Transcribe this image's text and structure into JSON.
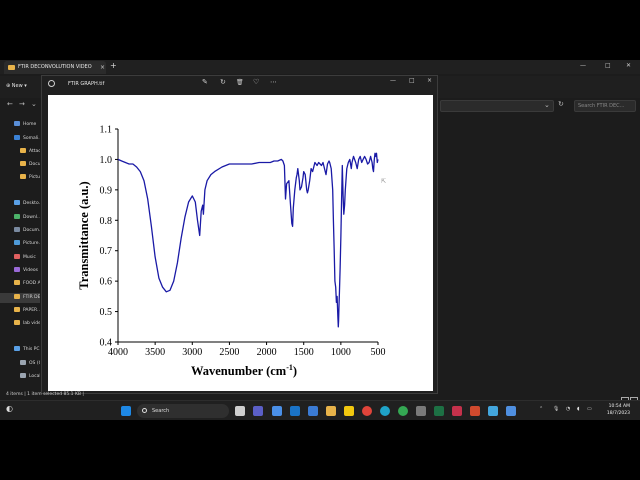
{
  "explorer": {
    "tab_title": "FTIR DECONVOLUTION VIDEO",
    "tab_close": "×",
    "tab_new": "+",
    "new_label": "New",
    "search_placeholder": "Search FTIR DEC...",
    "sidebar": [
      {
        "label": "Home",
        "icon": "home-icon",
        "color": "#5a8fd8"
      },
      {
        "label": "Somali...",
        "icon": "cloud-icon",
        "color": "#3b82d6"
      },
      {
        "label": "Attac...",
        "icon": "folder-icon",
        "color": "#e8b34a"
      },
      {
        "label": "Docu...",
        "icon": "folder-icon",
        "color": "#e8b34a"
      },
      {
        "label": "Pictur...",
        "icon": "folder-icon",
        "color": "#e8b34a"
      },
      {
        "label": "Deskto...",
        "icon": "desktop-icon",
        "color": "#5aa0e6"
      },
      {
        "label": "Downl...",
        "icon": "download-icon",
        "color": "#4cb36a"
      },
      {
        "label": "Docum...",
        "icon": "document-icon",
        "color": "#7a8aa0"
      },
      {
        "label": "Picture...",
        "icon": "pictures-icon",
        "color": "#4e9ad8"
      },
      {
        "label": "Music",
        "icon": "music-icon",
        "color": "#e06060"
      },
      {
        "label": "Videos",
        "icon": "video-icon",
        "color": "#9a6ad8"
      },
      {
        "label": "FOOD A...",
        "icon": "folder-icon",
        "color": "#e8b34a"
      },
      {
        "label": "FTIR DE...",
        "icon": "folder-icon",
        "color": "#e8b34a"
      },
      {
        "label": "PAPER...",
        "icon": "folder-icon",
        "color": "#e8b34a"
      },
      {
        "label": "lab vide...",
        "icon": "folder-icon",
        "color": "#e8b34a"
      },
      {
        "label": "This PC",
        "icon": "computer-icon",
        "color": "#5aa0e6"
      },
      {
        "label": "OS (C...",
        "icon": "drive-icon",
        "color": "#9aa4b0"
      },
      {
        "label": "Local...",
        "icon": "drive-icon",
        "color": "#9aa4b0"
      }
    ],
    "status": "4 items  |  1 item selected  85.1 KB  |"
  },
  "viewer": {
    "title": "FTIR GRAPH.tif",
    "tools": [
      "✎",
      "↻",
      "🗑",
      "♡",
      "⋯"
    ],
    "win_controls": [
      "—",
      "□",
      "×"
    ]
  },
  "taskbar": {
    "search_label": "Search",
    "time": "10:54 AM",
    "date": "18/7/2023",
    "accent": "#0078d4"
  },
  "chart_data": {
    "type": "line",
    "title": "",
    "xlabel": "Wavenumber (cm",
    "xlabel_sup": "-1",
    "xlabel_end": ")",
    "ylabel": "Transmittance (a.u.)",
    "xlim": [
      4000,
      500
    ],
    "ylim": [
      0.4,
      1.1
    ],
    "x_ticks": [
      4000,
      3500,
      3000,
      2500,
      2000,
      1500,
      1000,
      500
    ],
    "y_ticks": [
      0.4,
      0.5,
      0.6,
      0.7,
      0.8,
      0.9,
      1.0,
      1.1
    ],
    "line_color": "#1a1aa6",
    "series": [
      {
        "x": [
          4000,
          3950,
          3900,
          3850,
          3800,
          3750,
          3700,
          3650,
          3600,
          3550,
          3500,
          3450,
          3400,
          3350,
          3300,
          3250,
          3200,
          3150,
          3100,
          3050,
          3000,
          2960,
          2930,
          2900,
          2880,
          2860,
          2850,
          2830,
          2800,
          2750,
          2700,
          2600,
          2500,
          2400,
          2300,
          2200,
          2100,
          2000,
          1950,
          1900,
          1850,
          1800,
          1780,
          1760,
          1745,
          1730,
          1700,
          1680,
          1660,
          1650,
          1640,
          1620,
          1600,
          1590,
          1580,
          1560,
          1550,
          1530,
          1510,
          1500,
          1480,
          1460,
          1450,
          1440,
          1420,
          1400,
          1380,
          1350,
          1320,
          1300,
          1280,
          1260,
          1240,
          1220,
          1200,
          1180,
          1160,
          1150,
          1130,
          1110,
          1100,
          1090,
          1080,
          1070,
          1060,
          1050,
          1040,
          1035,
          1030,
          1025,
          1020,
          1010,
          1000,
          990,
          980,
          970,
          960,
          950,
          940,
          920,
          900,
          880,
          860,
          850,
          830,
          800,
          780,
          760,
          740,
          720,
          700,
          680,
          660,
          640,
          620,
          600,
          580,
          570,
          560,
          550,
          540,
          530,
          520,
          510,
          500
        ],
        "y": [
          1.0,
          0.995,
          0.99,
          0.985,
          0.985,
          0.975,
          0.96,
          0.93,
          0.87,
          0.78,
          0.68,
          0.61,
          0.58,
          0.565,
          0.57,
          0.6,
          0.66,
          0.74,
          0.81,
          0.86,
          0.88,
          0.86,
          0.8,
          0.75,
          0.83,
          0.85,
          0.82,
          0.9,
          0.93,
          0.95,
          0.96,
          0.975,
          0.985,
          0.985,
          0.985,
          0.985,
          0.99,
          0.99,
          0.99,
          0.995,
          0.995,
          1.0,
          0.995,
          0.98,
          0.87,
          0.92,
          0.93,
          0.86,
          0.79,
          0.78,
          0.84,
          0.9,
          0.94,
          0.95,
          0.97,
          0.93,
          0.9,
          0.91,
          0.94,
          0.96,
          0.95,
          0.9,
          0.89,
          0.9,
          0.93,
          0.97,
          0.96,
          0.99,
          0.98,
          0.99,
          0.985,
          0.98,
          0.99,
          0.97,
          0.95,
          0.985,
          0.995,
          0.99,
          0.97,
          0.9,
          0.8,
          0.7,
          0.6,
          0.58,
          0.53,
          0.55,
          0.48,
          0.45,
          0.47,
          0.52,
          0.56,
          0.64,
          0.75,
          0.87,
          0.98,
          0.88,
          0.82,
          0.85,
          0.9,
          0.97,
          0.99,
          1.0,
          0.97,
          0.99,
          1.01,
          0.99,
          0.97,
          1.0,
          1.01,
          0.99,
          1.0,
          1.01,
          1.0,
          0.985,
          0.99,
          1.01,
          0.99,
          0.97,
          0.96,
          1.0,
          1.02,
          1.01,
          1.02,
          0.99,
          1.0
        ]
      }
    ]
  }
}
